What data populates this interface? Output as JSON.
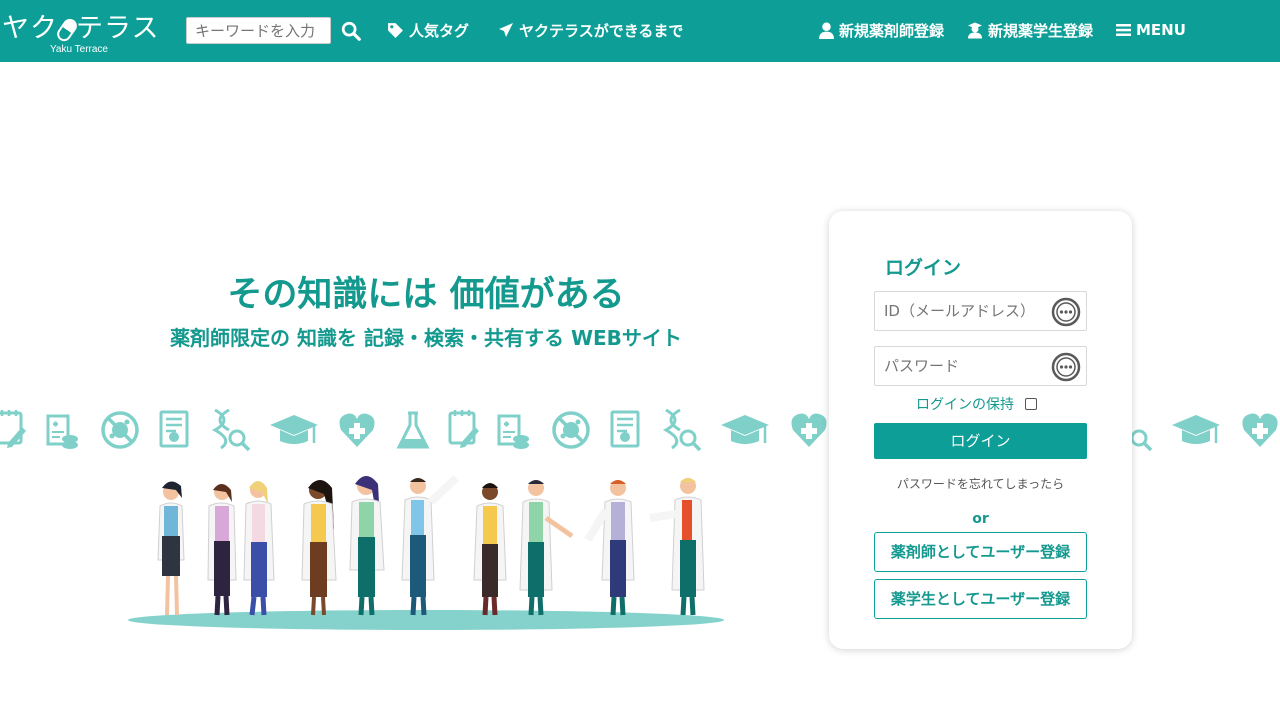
{
  "header": {
    "logo_text_pre": "ヤク",
    "logo_text_post": "テラス",
    "logo_sub": "Yaku Terrace",
    "search_placeholder": "キーワードを入力",
    "nav": {
      "tags": "人気タグ",
      "about": "ヤクテラスができるまで",
      "pharmacist_register": "新規薬剤師登録",
      "student_register": "新規薬学生登録",
      "menu": "MENU"
    }
  },
  "hero": {
    "title": "その知識には 価値がある",
    "subtitle": "薬剤師限定の 知識を 記録・検索・共有する WEBサイト"
  },
  "login": {
    "title": "ログイン",
    "id_placeholder": "ID（メールアドレス）",
    "password_placeholder": "パスワード",
    "keep_login": "ログインの保持",
    "login_button": "ログイン",
    "forgot": "パスワードを忘れてしまったら",
    "or": "or",
    "register_pharmacist": "薬剤師としてユーザー登録",
    "register_student": "薬学生としてユーザー登録"
  },
  "colors": {
    "brand": "#0d9f97",
    "text_accent": "#14998f",
    "icon_light": "#7fd0c9"
  },
  "icons": [
    "notepad-icon",
    "prescription-icon",
    "virus-icon",
    "document-icon",
    "dna-search-icon",
    "graduation-cap-icon",
    "heart-plus-icon",
    "flask-icon"
  ]
}
